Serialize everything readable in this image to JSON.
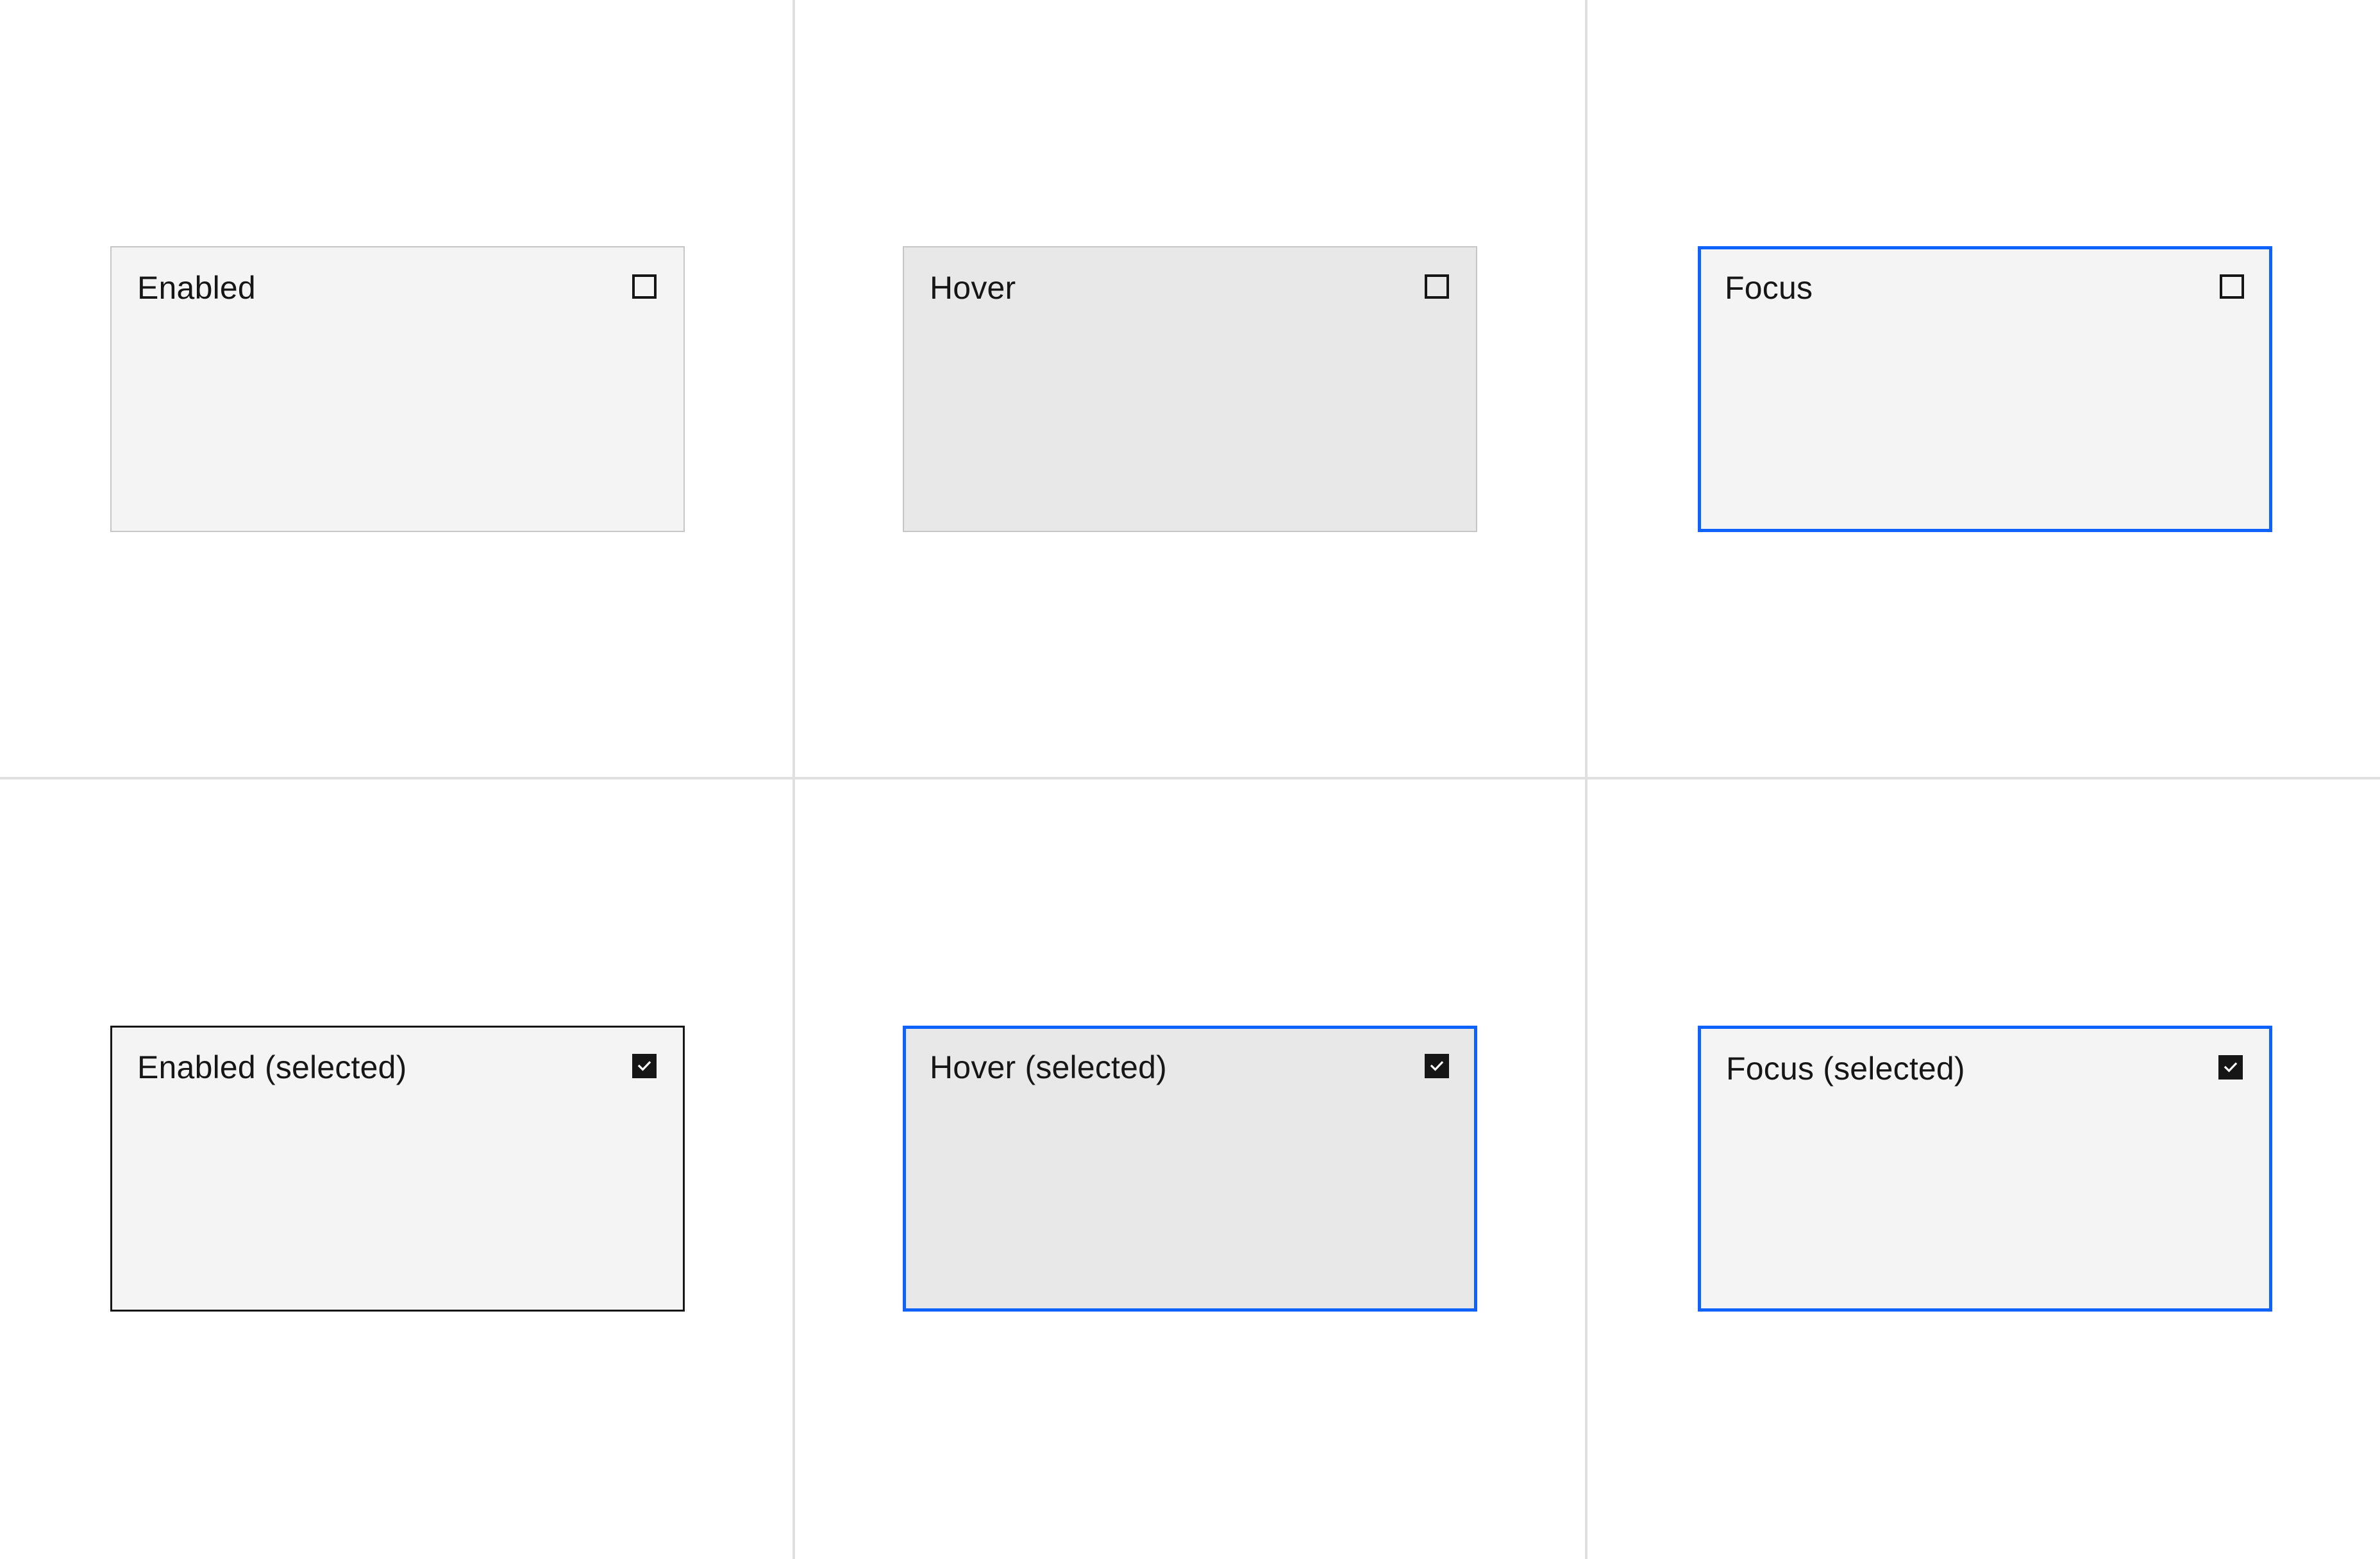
{
  "tiles": [
    {
      "label": "Enabled",
      "state": "enabled",
      "checked": false
    },
    {
      "label": "Hover",
      "state": "hover",
      "checked": false
    },
    {
      "label": "Focus",
      "state": "focus",
      "checked": false
    },
    {
      "label": "Enabled (selected)",
      "state": "enabled-selected",
      "checked": true
    },
    {
      "label": "Hover (selected)",
      "state": "hover-selected",
      "checked": true
    },
    {
      "label": "Focus (selected)",
      "state": "focus-selected",
      "checked": true
    }
  ],
  "icons": {
    "unchecked": "checkbox-unchecked-icon",
    "checked": "checkbox-checked-icon"
  },
  "colors": {
    "tile_background": "#f4f4f4",
    "tile_hover_background": "#e8e8e8",
    "tile_border": "#c6c6c6",
    "focus_border": "#0f62fe",
    "selected_border": "#161616",
    "text": "#161616",
    "grid_line": "#e0e0e0"
  }
}
